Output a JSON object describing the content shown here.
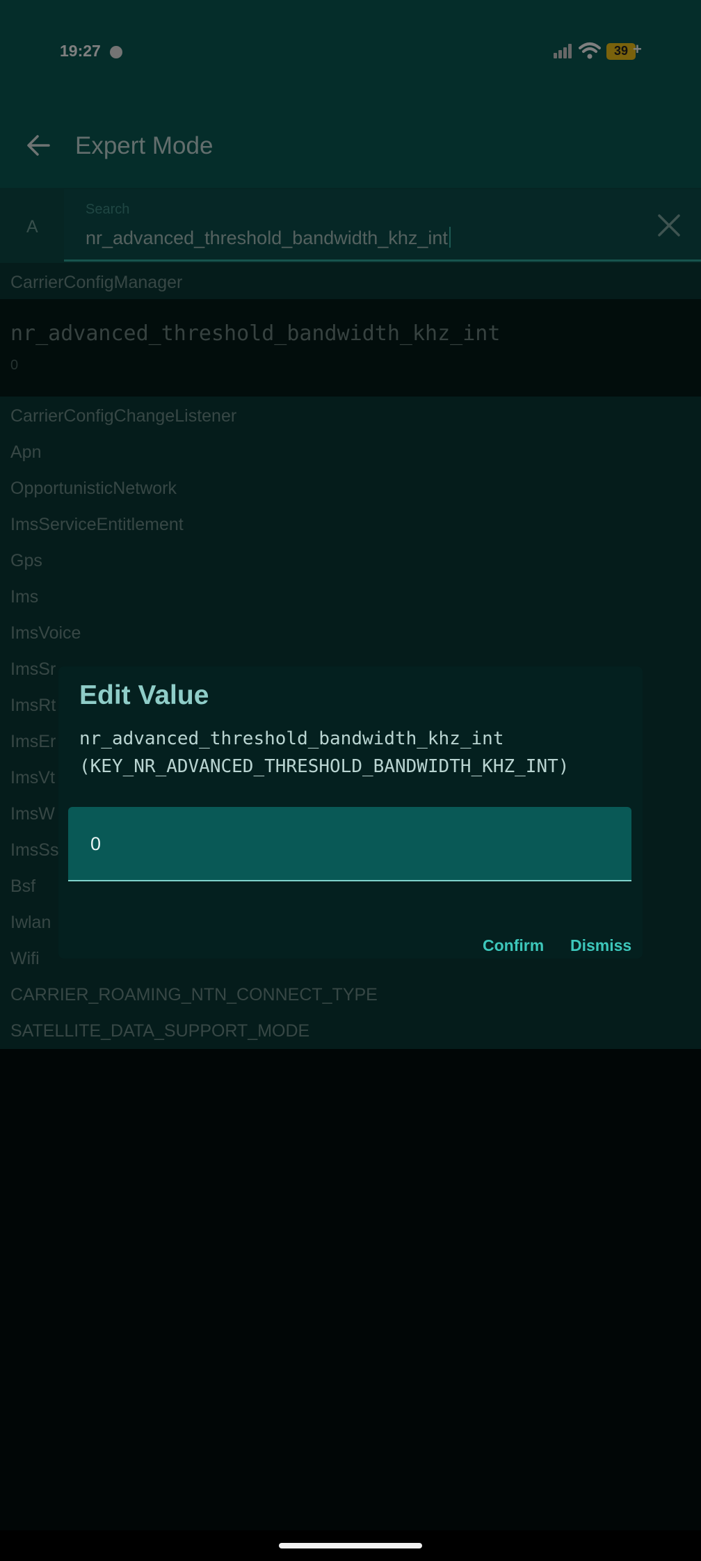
{
  "status_bar": {
    "time": "19:27",
    "battery": "39",
    "battery_suffix": "+"
  },
  "app_bar": {
    "title": "Expert Mode"
  },
  "search": {
    "prefix": "A",
    "label": "Search",
    "value": "nr_advanced_threshold_bandwidth_khz_int"
  },
  "sections": {
    "carrier_config_manager": "CarrierConfigManager",
    "items": [
      "CarrierConfigChangeListener",
      "Apn",
      "OpportunisticNetwork",
      "ImsServiceEntitlement",
      "Gps",
      "Ims",
      "ImsVoice",
      "ImsSr",
      "ImsRt",
      "ImsEr",
      "ImsVt",
      "ImsW",
      "ImsSs",
      "Bsf",
      "Iwlan",
      "Wifi",
      "CARRIER_ROAMING_NTN_CONNECT_TYPE",
      "SATELLITE_DATA_SUPPORT_MODE"
    ]
  },
  "result": {
    "name": "nr_advanced_threshold_bandwidth_khz_int",
    "value": "0"
  },
  "dialog": {
    "title": "Edit Value",
    "body": "nr_advanced_threshold_bandwidth_khz_int\n(KEY_NR_ADVANCED_THRESHOLD_BANDWIDTH_KHZ_INT)",
    "input_value": "0",
    "confirm_label": "Confirm",
    "dismiss_label": "Dismiss"
  },
  "colors": {
    "toolbar": "#0b5a55",
    "accent": "#3dc7bb",
    "battery": "#f5c518"
  },
  "icons": [
    "back-arrow-icon",
    "close-icon",
    "signal-icon",
    "wifi-icon",
    "battery-icon"
  ]
}
